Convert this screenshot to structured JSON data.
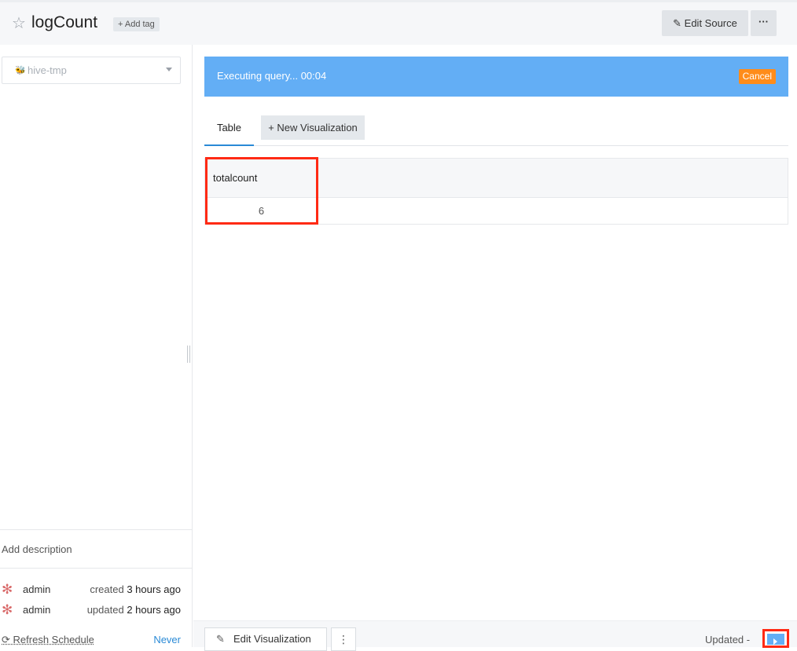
{
  "header": {
    "title": "logCount",
    "add_tag_label": "+ Add tag",
    "edit_source_label": "Edit Source",
    "more_label": "···"
  },
  "sidebar": {
    "data_source": "hive-tmp",
    "description_placeholder": "Add description",
    "meta": [
      {
        "user": "admin",
        "action": "created",
        "time": "3 hours ago"
      },
      {
        "user": "admin",
        "action": "updated",
        "time": "2 hours ago"
      }
    ],
    "refresh_schedule_label": "Refresh Schedule",
    "refresh_schedule_value": "Never"
  },
  "execution": {
    "status_text": "Executing query... 00:04",
    "cancel_label": "Cancel"
  },
  "tabs": [
    {
      "label": "Table"
    },
    {
      "label": "+ New Visualization"
    }
  ],
  "result": {
    "columns": [
      "totalcount"
    ],
    "rows": [
      [
        "6"
      ]
    ]
  },
  "footer": {
    "edit_visualization_label": "Edit Visualization",
    "kebab_label": "⋮",
    "updated_label": "Updated -"
  },
  "colors": {
    "exec_bar": "#63aef5",
    "cancel": "#ff8c1a",
    "highlight": "#ff2a14",
    "link": "#2a8ad6"
  }
}
